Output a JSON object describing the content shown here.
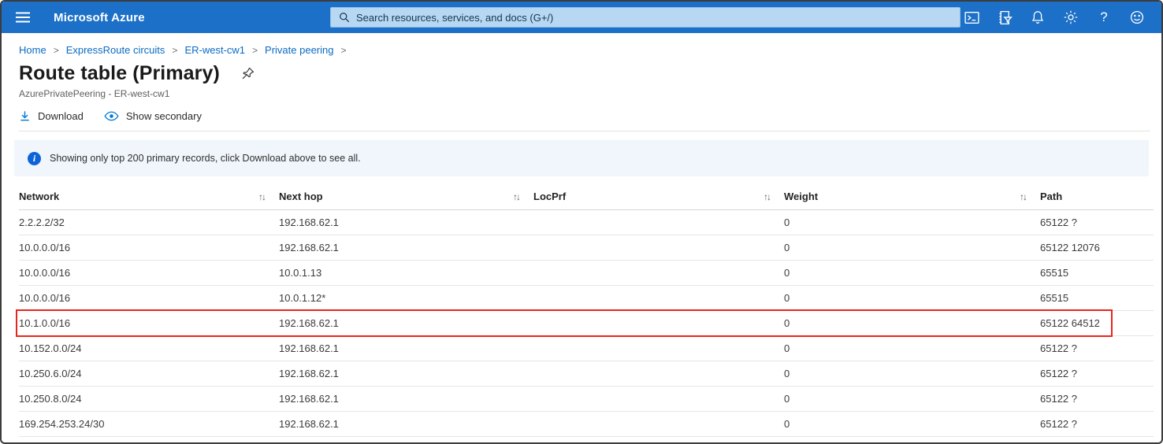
{
  "topbar": {
    "brand": "Microsoft Azure",
    "search_placeholder": "Search resources, services, and docs (G+/)",
    "icons": [
      "cloud-shell",
      "directory-filter",
      "notifications",
      "settings",
      "help",
      "feedback"
    ]
  },
  "breadcrumb": {
    "separator": ">",
    "items": [
      "Home",
      "ExpressRoute circuits",
      "ER-west-cw1",
      "Private peering"
    ]
  },
  "page": {
    "title": "Route table (Primary)",
    "subtitle": "AzurePrivatePeering - ER-west-cw1"
  },
  "toolbar": {
    "download": "Download",
    "show_secondary": "Show secondary"
  },
  "banner": {
    "text": "Showing only top 200 primary records, click Download above to see all."
  },
  "table": {
    "columns": [
      {
        "label": "Network",
        "sortable": true
      },
      {
        "label": "Next hop",
        "sortable": true
      },
      {
        "label": "LocPrf",
        "sortable": true
      },
      {
        "label": "Weight",
        "sortable": true
      },
      {
        "label": "Path",
        "sortable": false
      }
    ],
    "rows": [
      {
        "network": "2.2.2.2/32",
        "next_hop": "192.168.62.1",
        "locprf": "",
        "weight": "0",
        "path": "65122 ?"
      },
      {
        "network": "10.0.0.0/16",
        "next_hop": "192.168.62.1",
        "locprf": "",
        "weight": "0",
        "path": "65122 12076"
      },
      {
        "network": "10.0.0.0/16",
        "next_hop": "10.0.1.13",
        "locprf": "",
        "weight": "0",
        "path": "65515"
      },
      {
        "network": "10.0.0.0/16",
        "next_hop": "10.0.1.12*",
        "locprf": "",
        "weight": "0",
        "path": "65515"
      },
      {
        "network": "10.1.0.0/16",
        "next_hop": "192.168.62.1",
        "locprf": "",
        "weight": "0",
        "path": "65122 64512"
      },
      {
        "network": "10.152.0.0/24",
        "next_hop": "192.168.62.1",
        "locprf": "",
        "weight": "0",
        "path": "65122 ?"
      },
      {
        "network": "10.250.6.0/24",
        "next_hop": "192.168.62.1",
        "locprf": "",
        "weight": "0",
        "path": "65122 ?"
      },
      {
        "network": "10.250.8.0/24",
        "next_hop": "192.168.62.1",
        "locprf": "",
        "weight": "0",
        "path": "65122 ?"
      },
      {
        "network": "169.254.253.24/30",
        "next_hop": "192.168.62.1",
        "locprf": "",
        "weight": "0",
        "path": "65122 ?"
      }
    ],
    "highlighted_row_index": 4
  },
  "colors": {
    "topbar_blue": "#1c70c8",
    "accent_blue": "#0078d4",
    "search_bg": "#b7d7f2",
    "banner_bg": "#f0f6fc",
    "highlight_border_red": "#e8241c"
  }
}
